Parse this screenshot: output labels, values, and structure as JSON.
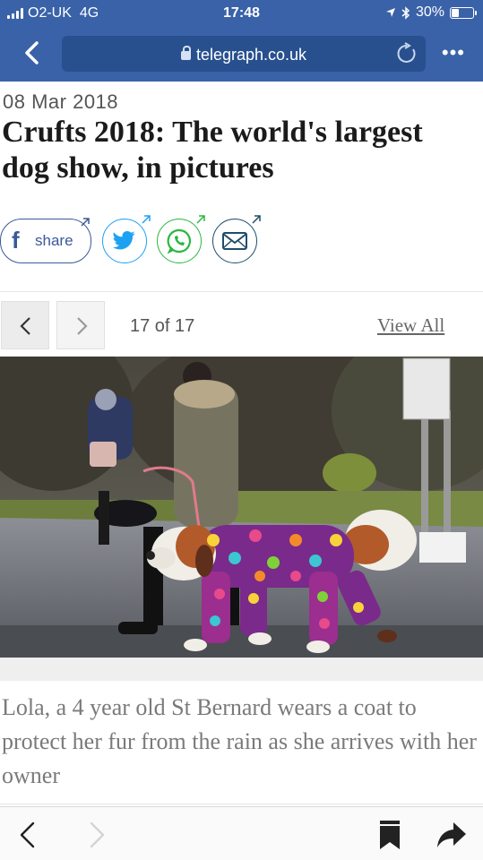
{
  "status_bar": {
    "carrier": "O2-UK",
    "network": "4G",
    "time": "17:48",
    "battery": "30%",
    "battery_level": 0.3
  },
  "browser": {
    "url": "telegraph.co.uk"
  },
  "article": {
    "date": "08 Mar 2018",
    "title": "Crufts 2018: The world's largest dog show, in pictures"
  },
  "share": {
    "facebook_label": "share"
  },
  "gallery": {
    "counter": "17 of 17",
    "view_all": "View All",
    "caption": "Lola, a 4 year old St Bernard wears a coat to protect her fur from the rain as she arrives with her owner"
  },
  "colors": {
    "header": "#3a62a8",
    "facebook": "#3b5998",
    "twitter": "#1da1f2",
    "whatsapp": "#2bb741",
    "email": "#1f4e6b"
  }
}
